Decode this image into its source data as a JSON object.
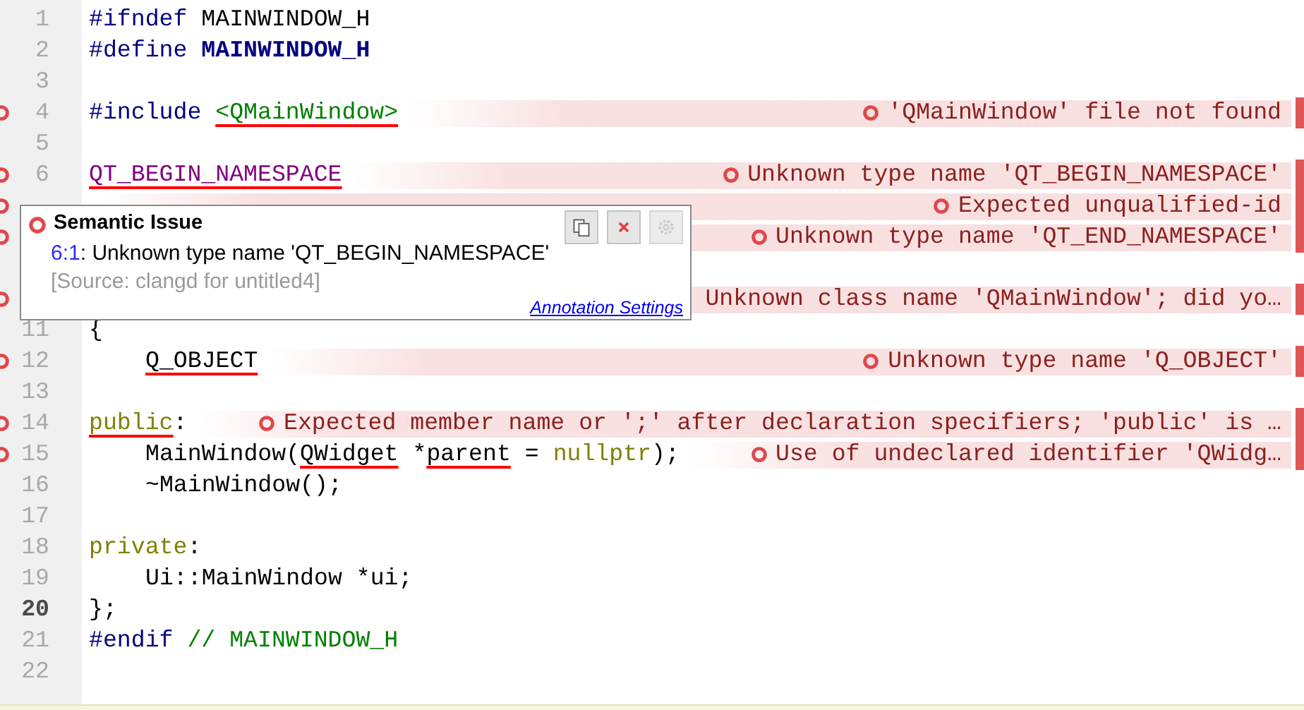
{
  "editor": {
    "lines": [
      {
        "number": "1",
        "current": false,
        "error": false,
        "indented": false,
        "code": [
          {
            "text": "#ifndef",
            "kind": "preproc"
          },
          {
            "text": " MAINWINDOW_H",
            "kind": "plain"
          }
        ]
      },
      {
        "number": "2",
        "current": false,
        "error": false,
        "indented": false,
        "code": [
          {
            "text": "#define ",
            "kind": "preproc"
          },
          {
            "text": "MAINWINDOW_H",
            "kind": "macro"
          }
        ]
      },
      {
        "number": "3",
        "current": false,
        "error": false
      },
      {
        "number": "4",
        "current": false,
        "error": true,
        "indented": false,
        "code": [
          {
            "text": "#include ",
            "kind": "preproc"
          },
          {
            "text": "<QMainWindow>",
            "kind": "string",
            "underline": true
          }
        ],
        "annotation": "'QMainWindow' file not found",
        "annotation_icon": true
      },
      {
        "number": "5",
        "current": false,
        "error": false
      },
      {
        "number": "6",
        "current": false,
        "error": true,
        "indented": false,
        "code": [
          {
            "text": "QT_BEGIN_NAMESPACE",
            "kind": "type-macro",
            "underline": true
          }
        ],
        "annotation": "Unknown type name 'QT_BEGIN_NAMESPACE'",
        "annotation_icon": true
      },
      {
        "error": true,
        "annotation": "Expected unqualified-id",
        "annotation_icon": true
      },
      {
        "error": true,
        "annotation": "Unknown type name 'QT_END_NAMESPACE'",
        "annotation_icon": true
      },
      {
        "error": false
      },
      {
        "error": true,
        "annotation": "Unknown class name 'QMainWindow'; did yo…",
        "annotation_icon": false
      },
      {
        "number": "11",
        "current": false,
        "error": false,
        "indented": false,
        "code": [
          {
            "text": "{",
            "kind": "plain"
          }
        ]
      },
      {
        "number": "12",
        "current": false,
        "error": true,
        "indented": true,
        "code": [
          {
            "text": "Q_OBJECT",
            "kind": "plain",
            "underline": true
          }
        ],
        "annotation": "Unknown type name 'Q_OBJECT'",
        "annotation_icon": true
      },
      {
        "number": "13",
        "current": false,
        "error": false
      },
      {
        "number": "14",
        "current": false,
        "error": true,
        "indented": false,
        "code": [
          {
            "text": "public",
            "kind": "keyword",
            "underline": true
          },
          {
            "text": ":",
            "kind": "plain"
          }
        ],
        "annotation": "Expected member name or ';' after declaration specifiers; 'public' is …",
        "annotation_icon": true
      },
      {
        "number": "15",
        "current": false,
        "error": true,
        "indented": true,
        "code": [
          {
            "text": "MainWindow(",
            "kind": "plain"
          },
          {
            "text": "QWidget",
            "kind": "plain",
            "underline": true
          },
          {
            "text": " *",
            "kind": "plain"
          },
          {
            "text": "parent",
            "kind": "plain",
            "underline": true
          },
          {
            "text": " = ",
            "kind": "plain"
          },
          {
            "text": "nullptr",
            "kind": "keyword"
          },
          {
            "text": ");",
            "kind": "plain"
          }
        ],
        "annotation": "Use of undeclared identifier 'QWidg…",
        "annotation_icon": true
      },
      {
        "number": "16",
        "current": false,
        "error": false,
        "indented": true,
        "code": [
          {
            "text": "~MainWindow();",
            "kind": "plain"
          }
        ]
      },
      {
        "number": "17",
        "current": false,
        "error": false
      },
      {
        "number": "18",
        "current": false,
        "error": false,
        "indented": false,
        "code": [
          {
            "text": "private",
            "kind": "keyword"
          },
          {
            "text": ":",
            "kind": "plain"
          }
        ]
      },
      {
        "number": "19",
        "current": false,
        "error": false,
        "indented": true,
        "code": [
          {
            "text": "Ui::MainWindow *ui;",
            "kind": "plain"
          }
        ]
      },
      {
        "number": "20",
        "current": true,
        "error": false,
        "indented": false,
        "code": [
          {
            "text": "};",
            "kind": "plain"
          }
        ]
      },
      {
        "number": "21",
        "current": false,
        "error": false,
        "indented": false,
        "code": [
          {
            "text": "#endif",
            "kind": "preproc"
          },
          {
            "text": " // MAINWINDOW_H",
            "kind": "comment"
          }
        ]
      },
      {
        "number": "22",
        "current": false,
        "error": false
      }
    ]
  },
  "tooltip": {
    "title": "Semantic Issue",
    "location": "6:1",
    "message": ": Unknown type name 'QT_BEGIN_NAMESPACE'",
    "source": "[Source: clangd for untitled4]",
    "buttons": [
      {
        "kind": "copy",
        "disabled": false
      },
      {
        "kind": "close",
        "disabled": false
      },
      {
        "kind": "settings",
        "disabled": true
      }
    ],
    "link": "Annotation Settings"
  }
}
